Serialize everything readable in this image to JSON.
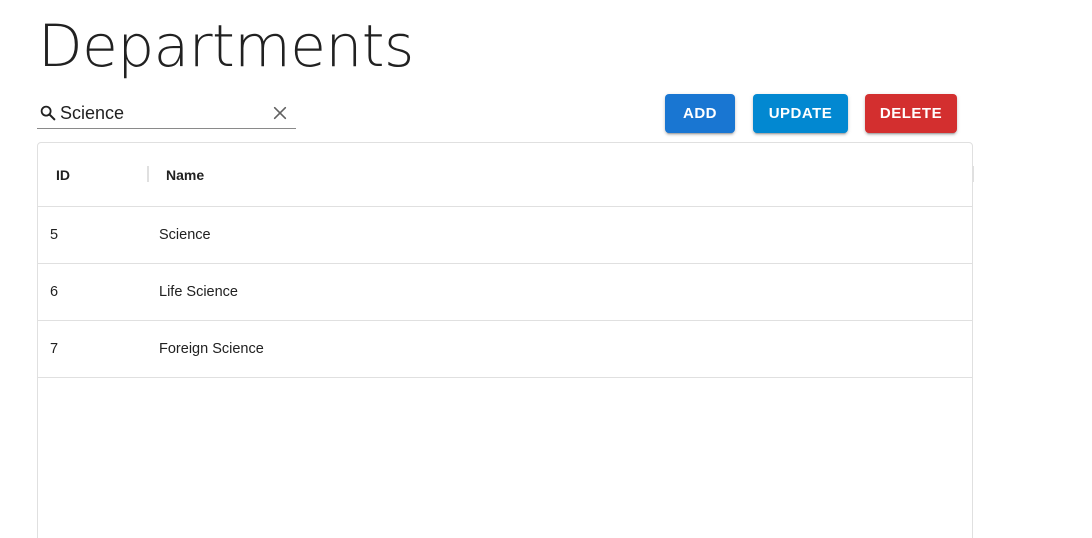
{
  "page": {
    "title": "Departments"
  },
  "search": {
    "value": "Science",
    "icon": "search-icon",
    "clear_icon": "close-icon"
  },
  "toolbar": {
    "add_label": "ADD",
    "update_label": "UPDATE",
    "delete_label": "DELETE",
    "colors": {
      "add": "#1976d2",
      "update": "#0288d1",
      "delete": "#d32f2f"
    }
  },
  "table": {
    "columns": [
      "ID",
      "Name"
    ],
    "rows": [
      {
        "id": "5",
        "name": "Science"
      },
      {
        "id": "6",
        "name": "Life Science"
      },
      {
        "id": "7",
        "name": "Foreign Science"
      }
    ]
  }
}
